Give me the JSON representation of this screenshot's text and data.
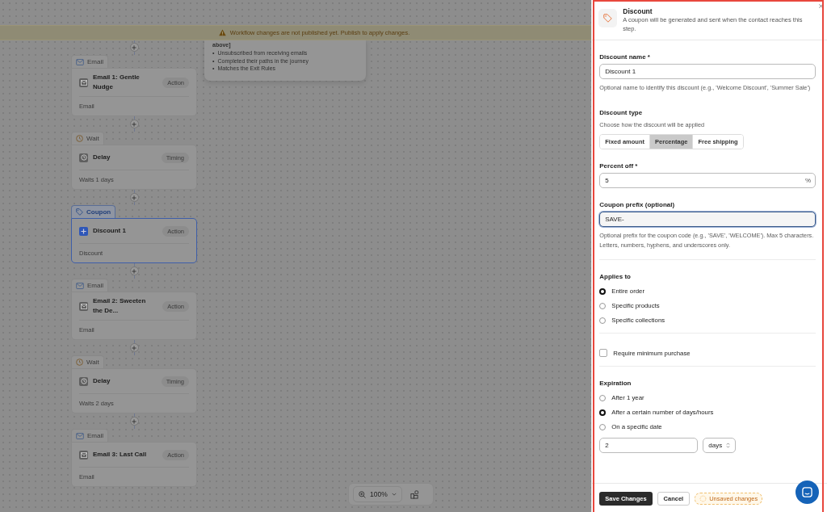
{
  "banner": {
    "text": "Workflow changes are not published yet. Publish to apply changes."
  },
  "popup": {
    "heading": "above]",
    "marker": "•",
    "items": [
      "Unsubscribed from receiving emails",
      "Completed their paths in the journey",
      "Matches the Exit Rules"
    ]
  },
  "steps": [
    {
      "kind": "email",
      "category": "Email",
      "title": "Email 1: Gentle Nudge",
      "badge": "Action",
      "subtitle": "Email",
      "selected": false
    },
    {
      "kind": "wait",
      "category": "Wait",
      "title": "Delay",
      "badge": "Timing",
      "subtitle": "Waits 1 days",
      "selected": false
    },
    {
      "kind": "coupon",
      "category": "Coupon",
      "title": "Discount 1",
      "badge": "Action",
      "subtitle": "Discount",
      "selected": true
    },
    {
      "kind": "email",
      "category": "Email",
      "title": "Email 2: Sweeten the De...",
      "badge": "Action",
      "subtitle": "Email",
      "selected": false
    },
    {
      "kind": "wait",
      "category": "Wait",
      "title": "Delay",
      "badge": "Timing",
      "subtitle": "Waits 2 days",
      "selected": false
    },
    {
      "kind": "email",
      "category": "Email",
      "title": "Email 3: Last Call",
      "badge": "Action",
      "subtitle": "Email",
      "selected": false
    }
  ],
  "zoom": {
    "value": "100%"
  },
  "panel": {
    "title": "Discount",
    "description": "A coupon will be generated and sent when the contact reaches this step.",
    "discount_name": {
      "label": "Discount name *",
      "value": "Discount 1",
      "help": "Optional name to identify this discount (e.g., 'Welcome Discount', 'Summer Sale')"
    },
    "discount_type": {
      "label": "Discount type",
      "help": "Choose how the discount will be applied",
      "options": [
        {
          "label": "Fixed amount",
          "selected": false
        },
        {
          "label": "Percentage",
          "selected": true
        },
        {
          "label": "Free shipping",
          "selected": false
        }
      ]
    },
    "percent_off": {
      "label": "Percent off *",
      "value": "5",
      "suffix": "%"
    },
    "coupon_prefix": {
      "label": "Coupon prefix (optional)",
      "value": "SAVE-",
      "help": "Optional prefix for the coupon code (e.g., 'SAVE', 'WELCOME'). Max 5 characters. Letters, numbers, hyphens, and underscores only."
    },
    "applies_to": {
      "label": "Applies to",
      "options": [
        {
          "label": "Entire order",
          "selected": true
        },
        {
          "label": "Specific products",
          "selected": false
        },
        {
          "label": "Specific collections",
          "selected": false
        }
      ]
    },
    "minimum_purchase": {
      "label": "Require minimum purchase",
      "checked": false
    },
    "expiration": {
      "label": "Expiration",
      "options": [
        {
          "label": "After 1 year",
          "selected": false
        },
        {
          "label": "After a certain number of days/hours",
          "selected": true
        },
        {
          "label": "On a specific date",
          "selected": false
        }
      ],
      "amount": "2",
      "unit": "days"
    },
    "buttons": {
      "save": "Save Changes",
      "cancel": "Cancel"
    },
    "status": "Unsaved changes"
  }
}
